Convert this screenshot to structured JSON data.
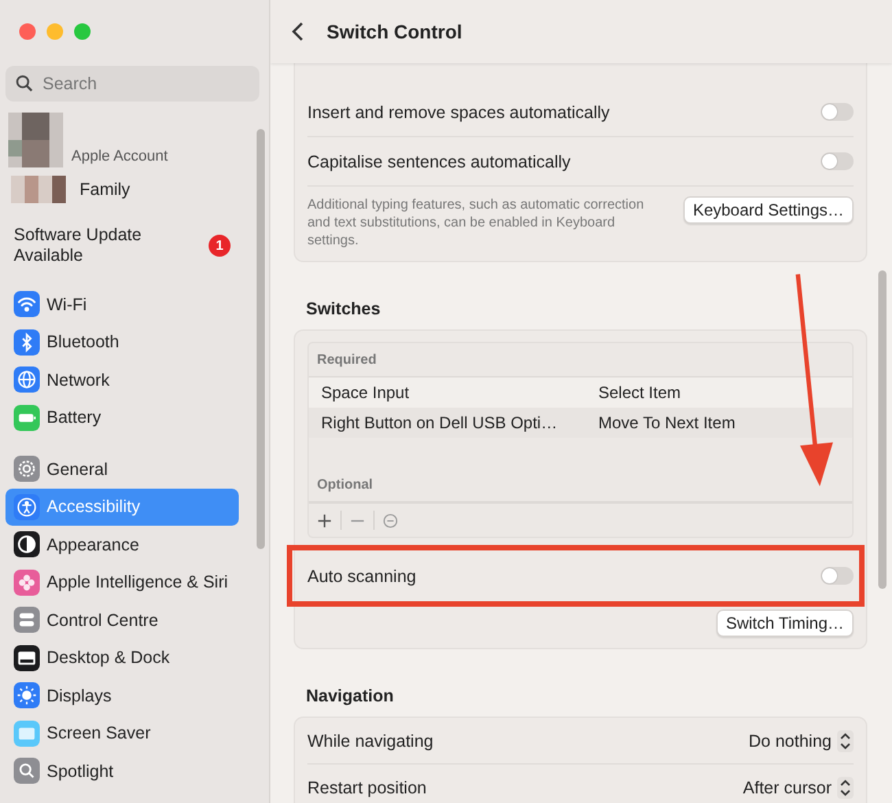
{
  "sidebar": {
    "search": {
      "placeholder": "Search"
    },
    "account": {
      "label": "Apple Account"
    },
    "family": {
      "label": "Family"
    },
    "update": {
      "label": "Software Update Available",
      "badge": "1"
    },
    "groups": [
      [
        {
          "label": "Wi-Fi",
          "kind": "wifi",
          "color": "#2f7cf6",
          "selected": false
        },
        {
          "label": "Bluetooth",
          "kind": "bluetooth",
          "color": "#2f7cf6",
          "selected": false
        },
        {
          "label": "Network",
          "kind": "globe",
          "color": "#2f7cf6",
          "selected": false
        },
        {
          "label": "Battery",
          "kind": "battery",
          "color": "#34c759",
          "selected": false
        }
      ],
      [
        {
          "label": "General",
          "kind": "gear",
          "color": "#8e8e93",
          "selected": false
        },
        {
          "label": "Accessibility",
          "kind": "person",
          "color": "#2f7cf6",
          "selected": true
        },
        {
          "label": "Appearance",
          "kind": "contrast",
          "color": "#1c1c1e",
          "selected": false
        },
        {
          "label": "Apple Intelligence & Siri",
          "kind": "flower",
          "color": "#e85d9a",
          "selected": false
        },
        {
          "label": "Control Centre",
          "kind": "toggles",
          "color": "#8e8e93",
          "selected": false
        },
        {
          "label": "Desktop & Dock",
          "kind": "dock",
          "color": "#1c1c1e",
          "selected": false
        },
        {
          "label": "Displays",
          "kind": "sun",
          "color": "#2f7cf6",
          "selected": false
        },
        {
          "label": "Screen Saver",
          "kind": "screen",
          "color": "#5ac8fa",
          "selected": false
        },
        {
          "label": "Spotlight",
          "kind": "search",
          "color": "#8e8e93",
          "selected": false
        }
      ]
    ]
  },
  "main": {
    "title": "Switch Control",
    "typing": {
      "toggles": [
        {
          "label": "Insert and remove spaces automatically",
          "on": false
        },
        {
          "label": "Capitalise sentences automatically",
          "on": false
        }
      ],
      "note": "Additional typing features, such as automatic correction and text substitutions, can be enabled in Keyboard settings.",
      "button": "Keyboard Settings…"
    },
    "switches": {
      "heading": "Switches",
      "groups": [
        {
          "label": "Required",
          "rows": [
            {
              "name": "Space Input",
              "action": "Select Item"
            },
            {
              "name": "Right Button on Dell USB Opti…",
              "action": "Move To Next Item"
            }
          ]
        },
        {
          "label": "Optional"
        }
      ],
      "auto_scanning": {
        "label": "Auto scanning",
        "on": false
      },
      "button": "Switch Timing…"
    },
    "navigation": {
      "heading": "Navigation",
      "rows": [
        {
          "label": "While navigating",
          "value": "Do nothing"
        },
        {
          "label": "Restart position",
          "value": "After cursor"
        }
      ]
    }
  }
}
